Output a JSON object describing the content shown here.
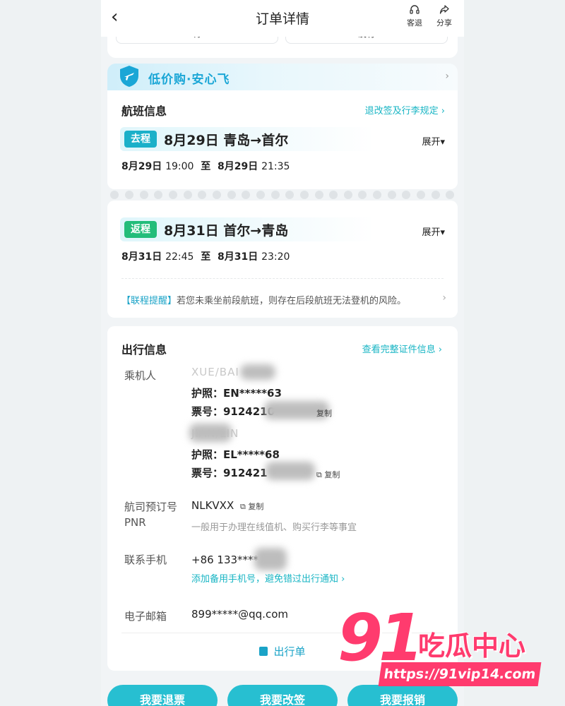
{
  "header": {
    "title": "订单详情",
    "back_icon": "‹",
    "refund_label": "客退",
    "share_label": "分享"
  },
  "top_card": {
    "left_text": "青",
    "right_text": "没有"
  },
  "banner": {
    "text": "低价购·安心飞"
  },
  "flight": {
    "title": "航班信息",
    "rules_link": "退改签及行李规定 ›",
    "outbound": {
      "tag": "去程",
      "route": "8月29日 青岛→首尔",
      "expand": "展开▾",
      "dep_date": "8月29日",
      "dep_time": "19:00",
      "to": "至",
      "arr_date": "8月29日",
      "arr_time": "21:35"
    },
    "return": {
      "tag": "返程",
      "route": "8月31日 首尔→青岛",
      "expand": "展开▾",
      "dep_date": "8月31日",
      "dep_time": "22:45",
      "to": "至",
      "arr_date": "8月31日",
      "arr_time": "23:20"
    },
    "reminder_tag": "【联程提醒】",
    "reminder_text": "若您未乘坐前段航班，则存在后段航班无法登机的风险。"
  },
  "travel": {
    "title": "出行信息",
    "cert_link": "查看完整证件信息 ›",
    "passenger_label": "乘机人",
    "passengers": [
      {
        "name": "XUE/BAI",
        "passport": "护照：EN*****63",
        "ticket": "票号：9124210",
        "copy": "复制"
      },
      {
        "name": "JIAN/LIN",
        "passport": "护照：EL*****68",
        "ticket": "票号：912421",
        "copy": "复制"
      }
    ],
    "pnr_label": "航司预订号",
    "pnr_label2": "PNR",
    "pnr_value": "NLKVXX",
    "pnr_copy": "复制",
    "pnr_hint": "一般用于办理在线值机、购买行李等事宜",
    "phone_label": "联系手机",
    "phone_value": "+86 133****",
    "phone_link": "添加备用手机号，避免错过出行通知 ›",
    "email_label": "电子邮箱",
    "email_value": "899*****@qq.com",
    "itinerary": "出行单"
  },
  "buttons": {
    "refund": "我要退票",
    "change": "我要改签",
    "reimburse": "我要报销"
  },
  "watermark": {
    "number": "91",
    "name": "吃瓜中心",
    "url": "https://91vip14.com"
  },
  "colors": {
    "accent": "#1aa3c7",
    "outbound_tag": "#1bb0c9",
    "return_tag": "#23bd7a",
    "button": "#27bfd1",
    "watermark": "#ff3b6e"
  }
}
